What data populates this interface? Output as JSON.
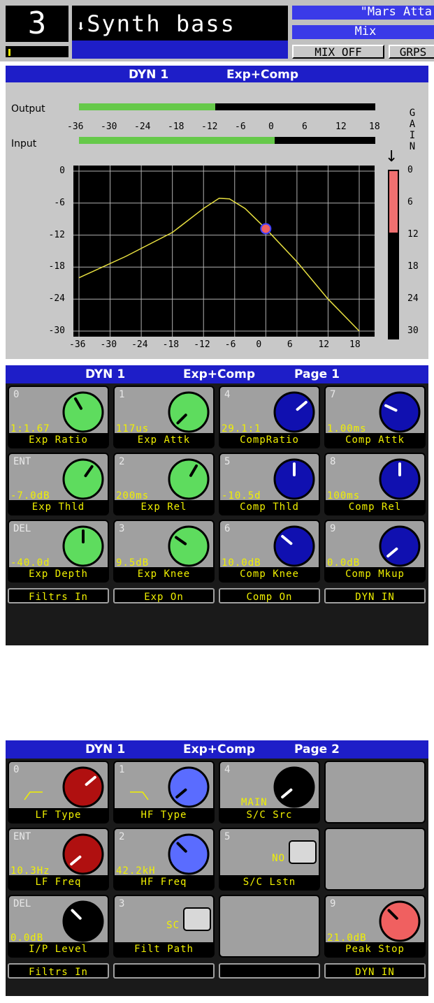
{
  "header": {
    "channel_number": "3",
    "channel_name": "Synth bass",
    "scene_name": "\"Mars Atta",
    "mode": "Mix",
    "mix_off_label": "MIX OFF",
    "grps_label": "GRPS"
  },
  "dyn_panel": {
    "title": "DYN 1",
    "mode": "Exp+Comp",
    "output_label": "Output",
    "input_label": "Input",
    "output_level_fraction": 0.46,
    "input_level_fraction": 0.66,
    "meter_scale": [
      "-36",
      "-30",
      "-24",
      "-18",
      "-12",
      "-6",
      "0",
      "6",
      "12",
      "18"
    ],
    "y_axis": [
      "0",
      "-6",
      "-12",
      "-18",
      "-24",
      "-30"
    ],
    "x_axis": [
      "-36",
      "-30",
      "-24",
      "-18",
      "-12",
      "-6",
      "0",
      "6",
      "12",
      "18"
    ],
    "gain_title": "GAIN",
    "gain_scale": [
      "0",
      "6",
      "12",
      "18",
      "24",
      "30"
    ],
    "gain_reduction_db": 11,
    "gain_arrow": "↓",
    "operating_point_db": 0
  },
  "page1": {
    "title": "DYN 1",
    "mode": "Exp+Comp",
    "page": "Page 1",
    "cells": [
      {
        "num": "0",
        "value": "1:1.67",
        "label": "Exp Ratio",
        "color": "#5edc5e",
        "angle": -30
      },
      {
        "num": "1",
        "value": "117us",
        "label": "Exp Attk",
        "color": "#5edc5e",
        "angle": -135
      },
      {
        "num": "4",
        "value": "29.1:1",
        "label": "CompRatio",
        "color": "#1010b0",
        "angle": 50
      },
      {
        "num": "7",
        "value": "1.00ms",
        "label": "Comp Attk",
        "color": "#1010b0",
        "angle": -65
      },
      {
        "num": "ENT",
        "value": "-7.0dB",
        "label": "Exp Thld",
        "color": "#5edc5e",
        "angle": 35
      },
      {
        "num": "2",
        "value": "200ms",
        "label": "Exp Rel",
        "color": "#5edc5e",
        "angle": 30
      },
      {
        "num": "5",
        "value": "-10.5d",
        "label": "Comp Thld",
        "color": "#1010b0",
        "angle": 0
      },
      {
        "num": "8",
        "value": "100ms",
        "label": "Comp Rel",
        "color": "#1010b0",
        "angle": 0
      },
      {
        "num": "DEL",
        "value": "-40.0d",
        "label": "Exp Depth",
        "color": "#5edc5e",
        "angle": 0
      },
      {
        "num": "3",
        "value": "9.5dB",
        "label": "Exp Knee",
        "color": "#5edc5e",
        "angle": -55
      },
      {
        "num": "6",
        "value": "10.0dB",
        "label": "Comp Knee",
        "color": "#1010b0",
        "angle": -50
      },
      {
        "num": "9",
        "value": "0.0dB",
        "label": "Comp Mkup",
        "color": "#1010b0",
        "angle": -130
      }
    ],
    "footer": [
      "Filtrs In",
      "Exp On",
      "Comp On",
      "DYN IN"
    ]
  },
  "page2": {
    "title": "DYN 1",
    "mode": "Exp+Comp",
    "page": "Page 2",
    "cells": [
      {
        "num": "0",
        "value": "",
        "label": "LF Type",
        "color": "#b01010",
        "angle": 50,
        "kind": "knob",
        "shape": "lf"
      },
      {
        "num": "1",
        "value": "",
        "label": "HF Type",
        "color": "#5a6cff",
        "angle": -130,
        "kind": "knob",
        "shape": "hf"
      },
      {
        "num": "4",
        "value": "MAIN",
        "label": "S/C Src",
        "color": "#000000",
        "angle": -130,
        "kind": "knob"
      },
      {
        "num": "7",
        "value": "",
        "label": "",
        "kind": "empty"
      },
      {
        "num": "ENT",
        "value": "10.3Hz",
        "label": "LF Freq",
        "color": "#b01010",
        "angle": -130,
        "kind": "knob"
      },
      {
        "num": "2",
        "value": "42.2kH",
        "label": "HF Freq",
        "color": "#5a6cff",
        "angle": -45,
        "kind": "knob"
      },
      {
        "num": "5",
        "value": "NO",
        "label": "S/C Lstn",
        "kind": "switch"
      },
      {
        "num": "8",
        "value": "",
        "label": "",
        "kind": "empty"
      },
      {
        "num": "DEL",
        "value": "0.0dB",
        "label": "I/P Level",
        "color": "#000000",
        "angle": -45,
        "kind": "knob"
      },
      {
        "num": "3",
        "value": "SC",
        "label": "Filt Path",
        "kind": "switch"
      },
      {
        "num": "6",
        "value": "",
        "label": "",
        "kind": "empty"
      },
      {
        "num": "9",
        "value": "21.0dB",
        "label": "Peak Stop",
        "color": "#f06060",
        "angle": -45,
        "kind": "knob"
      }
    ],
    "footer": [
      "Filtrs In",
      "",
      "",
      "DYN IN"
    ]
  }
}
